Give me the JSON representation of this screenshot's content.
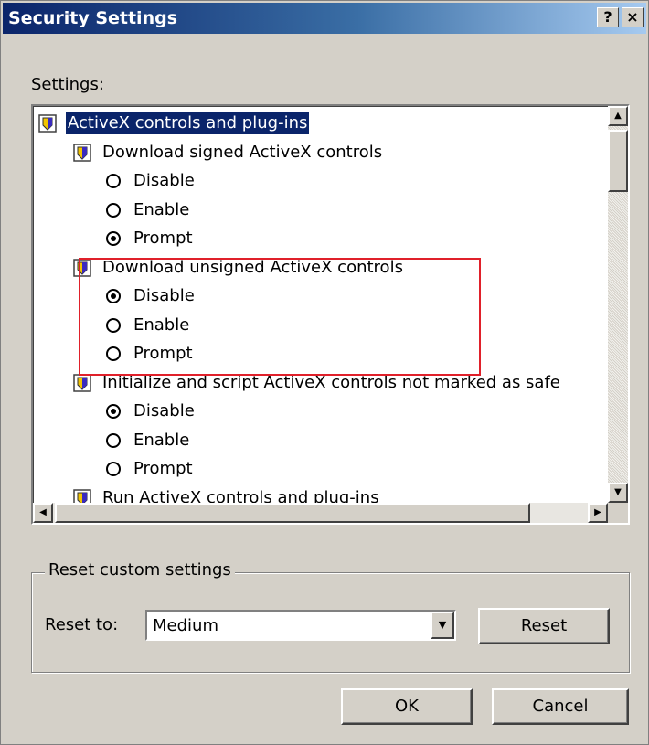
{
  "window": {
    "title": "Security Settings",
    "help_glyph": "?",
    "close_glyph": "×"
  },
  "settings_label": "Settings:",
  "tree": [
    {
      "text": "ActiveX controls and plug-ins",
      "kind": "category",
      "selected": true
    },
    {
      "text": "Download signed ActiveX controls",
      "kind": "setting"
    },
    {
      "text": "Disable",
      "kind": "option",
      "checked": false
    },
    {
      "text": "Enable",
      "kind": "option",
      "checked": false
    },
    {
      "text": "Prompt",
      "kind": "option",
      "checked": true
    },
    {
      "text": "Download unsigned ActiveX controls",
      "kind": "setting"
    },
    {
      "text": "Disable",
      "kind": "option",
      "checked": true
    },
    {
      "text": "Enable",
      "kind": "option",
      "checked": false
    },
    {
      "text": "Prompt",
      "kind": "option",
      "checked": false
    },
    {
      "text": "Initialize and script ActiveX controls not marked as safe",
      "kind": "setting"
    },
    {
      "text": "Disable",
      "kind": "option",
      "checked": true
    },
    {
      "text": "Enable",
      "kind": "option",
      "checked": false
    },
    {
      "text": "Prompt",
      "kind": "option",
      "checked": false
    },
    {
      "text": "Run ActiveX controls and plug-ins",
      "kind": "setting"
    }
  ],
  "reset_group": {
    "legend": "Reset custom settings",
    "reset_to_label": "Reset to:",
    "reset_to_value": "Medium",
    "reset_button": "Reset"
  },
  "buttons": {
    "ok": "OK",
    "cancel": "Cancel"
  },
  "colors": {
    "title_bar": "#0a246a",
    "face": "#d4d0c8",
    "highlight_box": "#e0202a",
    "selection": "#0a246a"
  }
}
